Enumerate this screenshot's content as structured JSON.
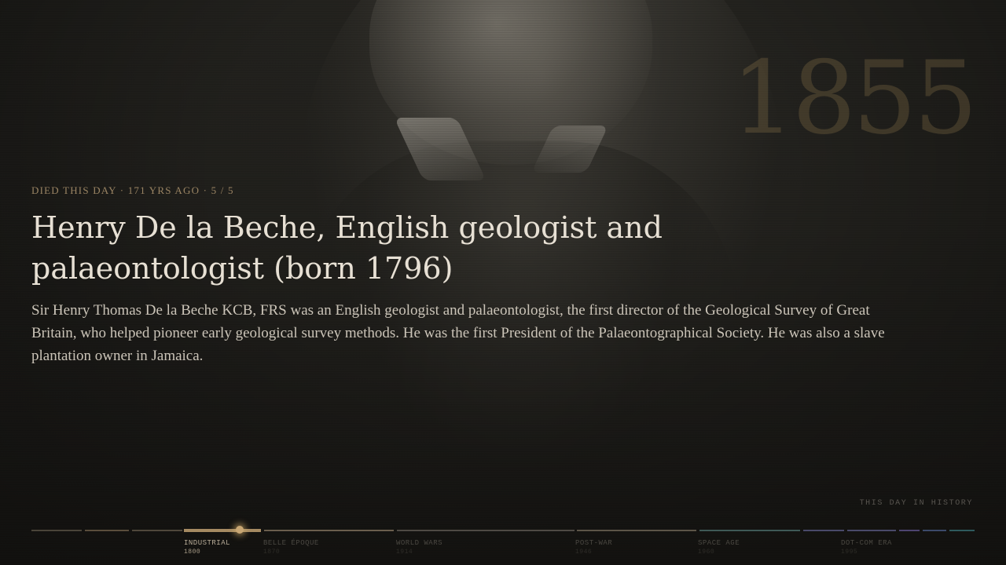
{
  "watermark_year": "1855",
  "event": {
    "meta": "DIED THIS DAY · 171 YRS AGO · 5 / 5",
    "title": "Henry De la Beche, English geologist and palaeontologist (born 1796)",
    "summary": "Sir Henry Thomas De la Beche KCB, FRS was an English geologist and palaeontologist, the first director of the Geological Survey of Great Britain, who helped pioneer early geological survey methods. He was the first President of the Palaeontographical Society. He was also a slave plantation owner in Jamaica."
  },
  "brand": "THIS DAY IN HISTORY",
  "timeline": {
    "eras": [
      {
        "name": "INDUSTRIAL",
        "year": "1800",
        "color": "#a58a62",
        "active": true
      },
      {
        "name": "BELLE ÉPOQUE",
        "year": "1870",
        "color": "#6b5e4d",
        "active": false
      },
      {
        "name": "WORLD WARS",
        "year": "1914",
        "color": "#4e4a44",
        "active": false
      },
      {
        "name": "POST-WAR",
        "year": "1946",
        "color": "#5c5548",
        "active": false
      },
      {
        "name": "SPACE AGE",
        "year": "1960",
        "color": "#3f5956",
        "active": false
      },
      {
        "name": "DOT-COM ERA",
        "year": "1995",
        "color": "#4a4a6a",
        "active": false
      }
    ],
    "current_year": 1855,
    "accent_color": "#c9a774"
  }
}
